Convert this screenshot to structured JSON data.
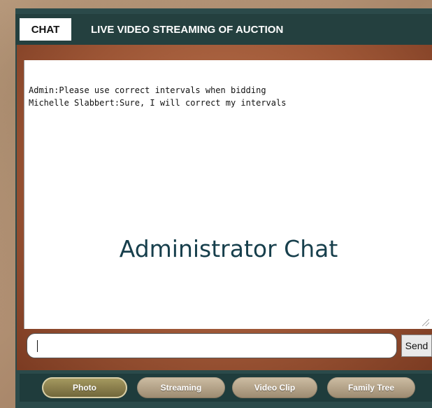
{
  "tabs": {
    "chat_label": "CHAT",
    "stream_label": "LIVE VIDEO STREAMING OF AUCTION"
  },
  "chat": {
    "messages": [
      "Admin:Please use correct intervals when bidding",
      "Michelle Slabbert:Sure, I will correct my intervals"
    ],
    "overlay_title": "Administrator Chat"
  },
  "input": {
    "value": "",
    "send_label": "Send"
  },
  "nav": {
    "buttons": [
      {
        "label": "Photo",
        "active": true
      },
      {
        "label": "Streaming",
        "active": false
      },
      {
        "label": "Video Clip",
        "active": false
      },
      {
        "label": "Family Tree",
        "active": false
      }
    ]
  },
  "colors": {
    "header_bg": "#24403f",
    "copper_panel": "#9c5535",
    "title_text": "#173f4c"
  }
}
